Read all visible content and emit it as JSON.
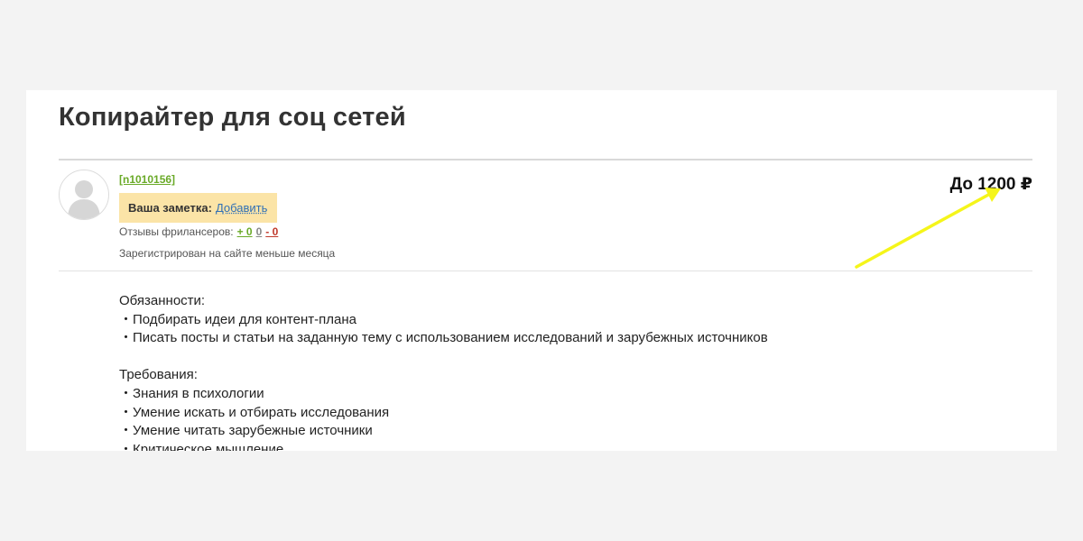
{
  "job": {
    "title": "Копирайтер для соц сетей",
    "price": "До 1200 ₽"
  },
  "author": {
    "username": "[n1010156]",
    "note_label": "Ваша заметка:",
    "note_add": "Добавить",
    "reviews_label": "Отзывы фрилансеров:",
    "reviews_positive": "+ 0",
    "reviews_neutral": "0",
    "reviews_negative": "- 0",
    "registered": "Зарегистрирован на сайте меньше месяца"
  },
  "description": {
    "duties_heading": "Обязанности:",
    "duties": [
      "Подбирать идеи для контент-плана",
      "Писать посты и статьи на заданную тему с использованием исследований и зарубежных источников"
    ],
    "requirements_heading": "Требования:",
    "requirements": [
      "Знания в психологии",
      "Умение искать и отбирать исследования",
      "Умение читать зарубежные источники",
      "Критическое мышление"
    ]
  },
  "colors": {
    "background": "#f3f3f3",
    "card": "#ffffff",
    "link_green": "#6aaa28",
    "note_bg": "#fbe4a7",
    "link_blue": "#2f6fb5",
    "negative_red": "#c0392b",
    "annotation_arrow": "#f5f51a"
  },
  "icons": {
    "avatar": "user-silhouette-icon",
    "annotation": "arrow-annotation-icon"
  }
}
